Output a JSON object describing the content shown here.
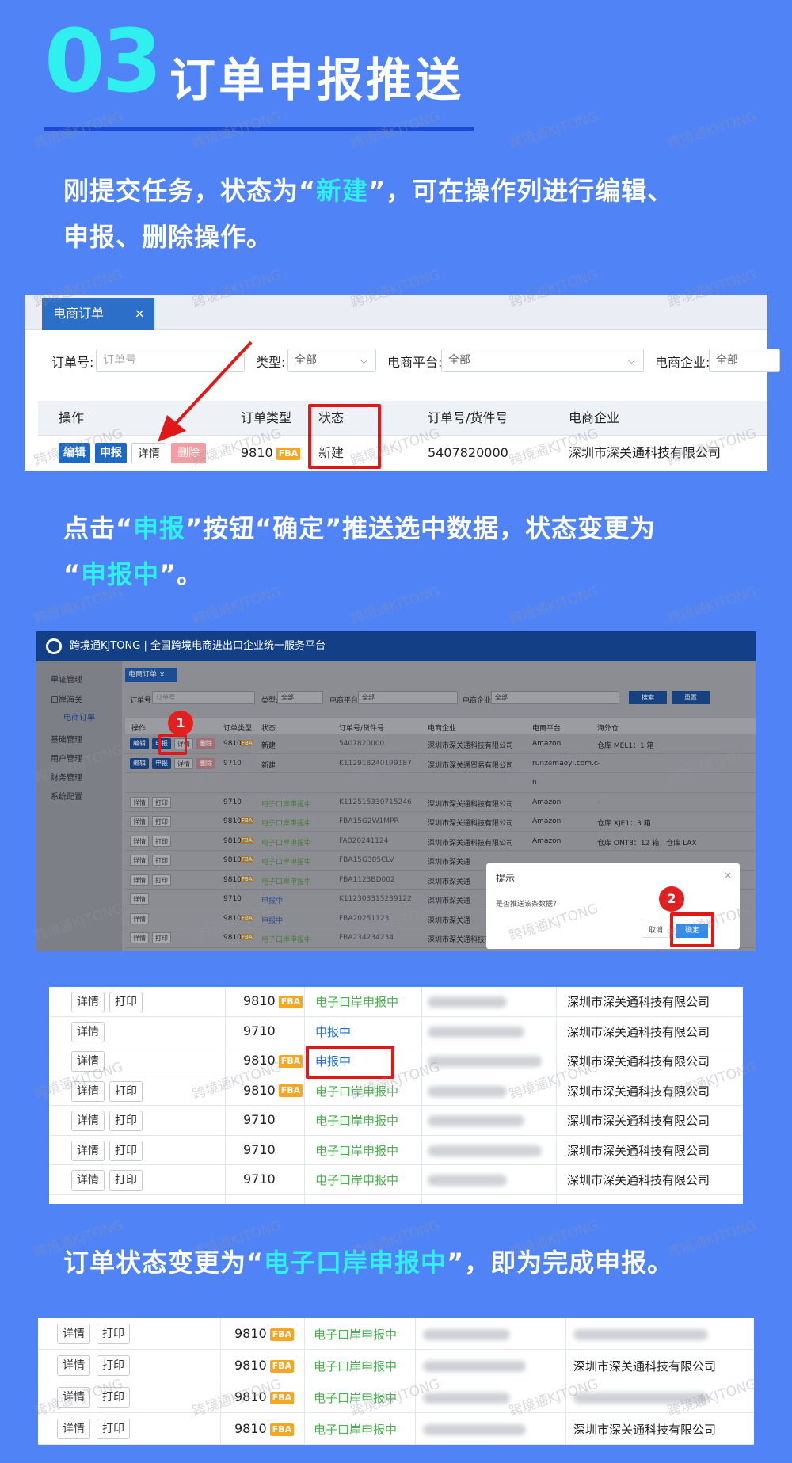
{
  "header": {
    "step_number": "03",
    "title": "订单申报推送"
  },
  "paragraphs": {
    "p1_a": "刚提交任务，状态为“",
    "p1_hl": "新建",
    "p1_b": "”，可在操作列进行编辑、",
    "p1_c": "申报、删除操作。",
    "p2_a": "点击“",
    "p2_hl1": "申报",
    "p2_b": "”按钮“确定”推送选中数据，状态变更为",
    "p2_c": "“",
    "p2_hl2": "申报中",
    "p2_d": "”。",
    "p3_a": "订单状态变更为“",
    "p3_hl": "电子口岸申报中",
    "p3_b": "”，即为完成申报。"
  },
  "shot1": {
    "tab_label": "电商订单",
    "tab_close": "×",
    "order_no_label": "订单号:",
    "order_no_placeholder": "订单号",
    "type_label": "类型:",
    "type_value": "全部",
    "platform_label": "电商平台:",
    "platform_value": "全部",
    "company_label": "电商企业:",
    "company_value": "全部",
    "columns": [
      "操作",
      "订单类型",
      "状态",
      "订单号/货件号",
      "电商企业"
    ],
    "row": {
      "btn_edit": "编辑",
      "btn_declare": "申报",
      "btn_detail": "详情",
      "btn_delete": "删除",
      "order_type": "9810",
      "fba": "FBA",
      "status": "新建",
      "order_no": "5407820000",
      "company": "深圳市深关通科技有限公司"
    }
  },
  "shot2": {
    "app_title": "跨境通KJTONG | 全国跨境电商进出口企业统一服务平台",
    "sidebar": [
      "单证管理",
      "口岸海关",
      "电商订单",
      "基础管理",
      "用户管理",
      "财务管理",
      "系统配置"
    ],
    "tab_label": "电商订单 ×",
    "filters": {
      "order_no": "订单号:",
      "order_no_ph": "订单号",
      "type": "类型:",
      "type_val": "全部",
      "platform": "电商平台:",
      "platform_val": "全部",
      "company": "电商企业:",
      "company_val": "全部",
      "search": "搜索",
      "reset": "重置"
    },
    "columns": [
      "操作",
      "订单类型",
      "状态",
      "订单号/货件号",
      "电商企业",
      "电商平台",
      "海外仓"
    ],
    "rows": [
      {
        "ops": [
          "编辑",
          "申报",
          "详情",
          "删除"
        ],
        "type": "9810",
        "fba": true,
        "status": "新建",
        "no": "5407820000",
        "company": "深圳市深关通科技有限公司",
        "platform": "Amazon",
        "wh": "仓库 MEL1：1 箱"
      },
      {
        "ops": [
          "编辑",
          "申报",
          "详情",
          "删除"
        ],
        "type": "9710",
        "fba": false,
        "status": "新建",
        "no": "K112918240199187",
        "company": "深圳市深关通贸易有限公司",
        "platform": "runzemaoyi.com.c",
        "wh": "-"
      },
      {
        "ops": [],
        "type": "",
        "fba": false,
        "status": "",
        "no": "",
        "company": "",
        "platform": "n",
        "wh": ""
      },
      {
        "ops": [
          "详情",
          "打印"
        ],
        "type": "9710",
        "fba": false,
        "status": "电子口岸申报中",
        "no": "K112515330715246",
        "company": "深圳市深关通科技有限公司",
        "platform": "Amazon",
        "wh": "-"
      },
      {
        "ops": [
          "详情",
          "打印"
        ],
        "type": "9810",
        "fba": true,
        "status": "电子口岸申报中",
        "no": "FBA15G2W1MPR",
        "company": "深圳市深关通科技有限公司",
        "platform": "Amazon",
        "wh": "仓库 XJE1：3 箱"
      },
      {
        "ops": [
          "详情",
          "打印"
        ],
        "type": "9810",
        "fba": true,
        "status": "电子口岸申报中",
        "no": "FAB20241124",
        "company": "深圳市深关通科技有限公司",
        "platform": "Amazon",
        "wh": "仓库 ONT8：12 箱；仓库 LAX"
      },
      {
        "ops": [
          "详情",
          "打印"
        ],
        "type": "9810",
        "fba": true,
        "status": "电子口岸申报中",
        "no": "FBA15G385CLV",
        "company": "深圳市深关通",
        "platform": "",
        "wh": ""
      },
      {
        "ops": [
          "详情",
          "打印"
        ],
        "type": "9810",
        "fba": true,
        "status": "电子口岸申报中",
        "no": "FBA1123BD002",
        "company": "深圳市深关通",
        "platform": "",
        "wh": ""
      },
      {
        "ops": [
          "详情"
        ],
        "type": "9710",
        "fba": false,
        "status": "申报中",
        "no": "K112303315239122",
        "company": "深圳市深关通",
        "platform": "",
        "wh": ""
      },
      {
        "ops": [
          "详情"
        ],
        "type": "9810",
        "fba": true,
        "status": "申报中",
        "no": "FBA20251123",
        "company": "深圳市深关通",
        "platform": "",
        "wh": ""
      },
      {
        "ops": [
          "详情",
          "打印"
        ],
        "type": "9810",
        "fba": true,
        "status": "电子口岸申报中",
        "no": "FBA234234234",
        "company": "深圳市深关通科技有限公司",
        "platform": "Amazon",
        "wh": "MF3"
      }
    ],
    "dialog": {
      "title": "提示",
      "close": "×",
      "message": "是否推送该条数据?",
      "cancel": "取消",
      "confirm": "确定"
    },
    "step1": "1",
    "step2": "2"
  },
  "shot3": {
    "rows": [
      {
        "ops": [
          "详情",
          "打印"
        ],
        "type": "9810",
        "fba": true,
        "status": "电子口岸申报中",
        "status_kind": "green",
        "company": "深圳市深关通科技有限公司"
      },
      {
        "ops": [
          "详情"
        ],
        "type": "9710",
        "fba": false,
        "status": "申报中",
        "status_kind": "blue",
        "company": "深圳市深关通科技有限公司"
      },
      {
        "ops": [
          "详情"
        ],
        "type": "9810",
        "fba": true,
        "status": "申报中",
        "status_kind": "blue",
        "company": "深圳市深关通科技有限公司"
      },
      {
        "ops": [
          "详情",
          "打印"
        ],
        "type": "9810",
        "fba": true,
        "status": "电子口岸申报中",
        "status_kind": "green",
        "company": "深圳市深关通科技有限公司"
      },
      {
        "ops": [
          "详情",
          "打印"
        ],
        "type": "9710",
        "fba": false,
        "status": "电子口岸申报中",
        "status_kind": "green",
        "company": "深圳市深关通科技有限公司"
      },
      {
        "ops": [
          "详情",
          "打印"
        ],
        "type": "9710",
        "fba": false,
        "status": "电子口岸申报中",
        "status_kind": "green",
        "company": "深圳市深关通科技有限公司"
      },
      {
        "ops": [
          "详情",
          "打印"
        ],
        "type": "9710",
        "fba": false,
        "status": "电子口岸申报中",
        "status_kind": "green",
        "company": "深圳市深关通科技有限公司"
      }
    ]
  },
  "shot4": {
    "rows": [
      {
        "ops": [
          "详情",
          "打印"
        ],
        "type": "9810",
        "fba": true,
        "status": "电子口岸申报中",
        "company": ""
      },
      {
        "ops": [
          "详情",
          "打印"
        ],
        "type": "9810",
        "fba": true,
        "status": "电子口岸申报中",
        "company": "深圳市深关通科技有限公司"
      },
      {
        "ops": [
          "详情",
          "打印"
        ],
        "type": "9810",
        "fba": true,
        "status": "电子口岸申报中",
        "company": ""
      },
      {
        "ops": [
          "详情",
          "打印"
        ],
        "type": "9810",
        "fba": true,
        "status": "电子口岸申报中",
        "company": "深圳市深关通科技有限公司"
      }
    ]
  },
  "watermark": "跨境通KJTONG",
  "colors": {
    "background": "#4f83f6",
    "highlight": "#2ff0ee",
    "title_line": "#1c4ad0",
    "primary_button": "#1c69c7",
    "status_green": "#4caf50",
    "status_blue": "#1f6fd1",
    "annotation_red": "#e01818"
  }
}
